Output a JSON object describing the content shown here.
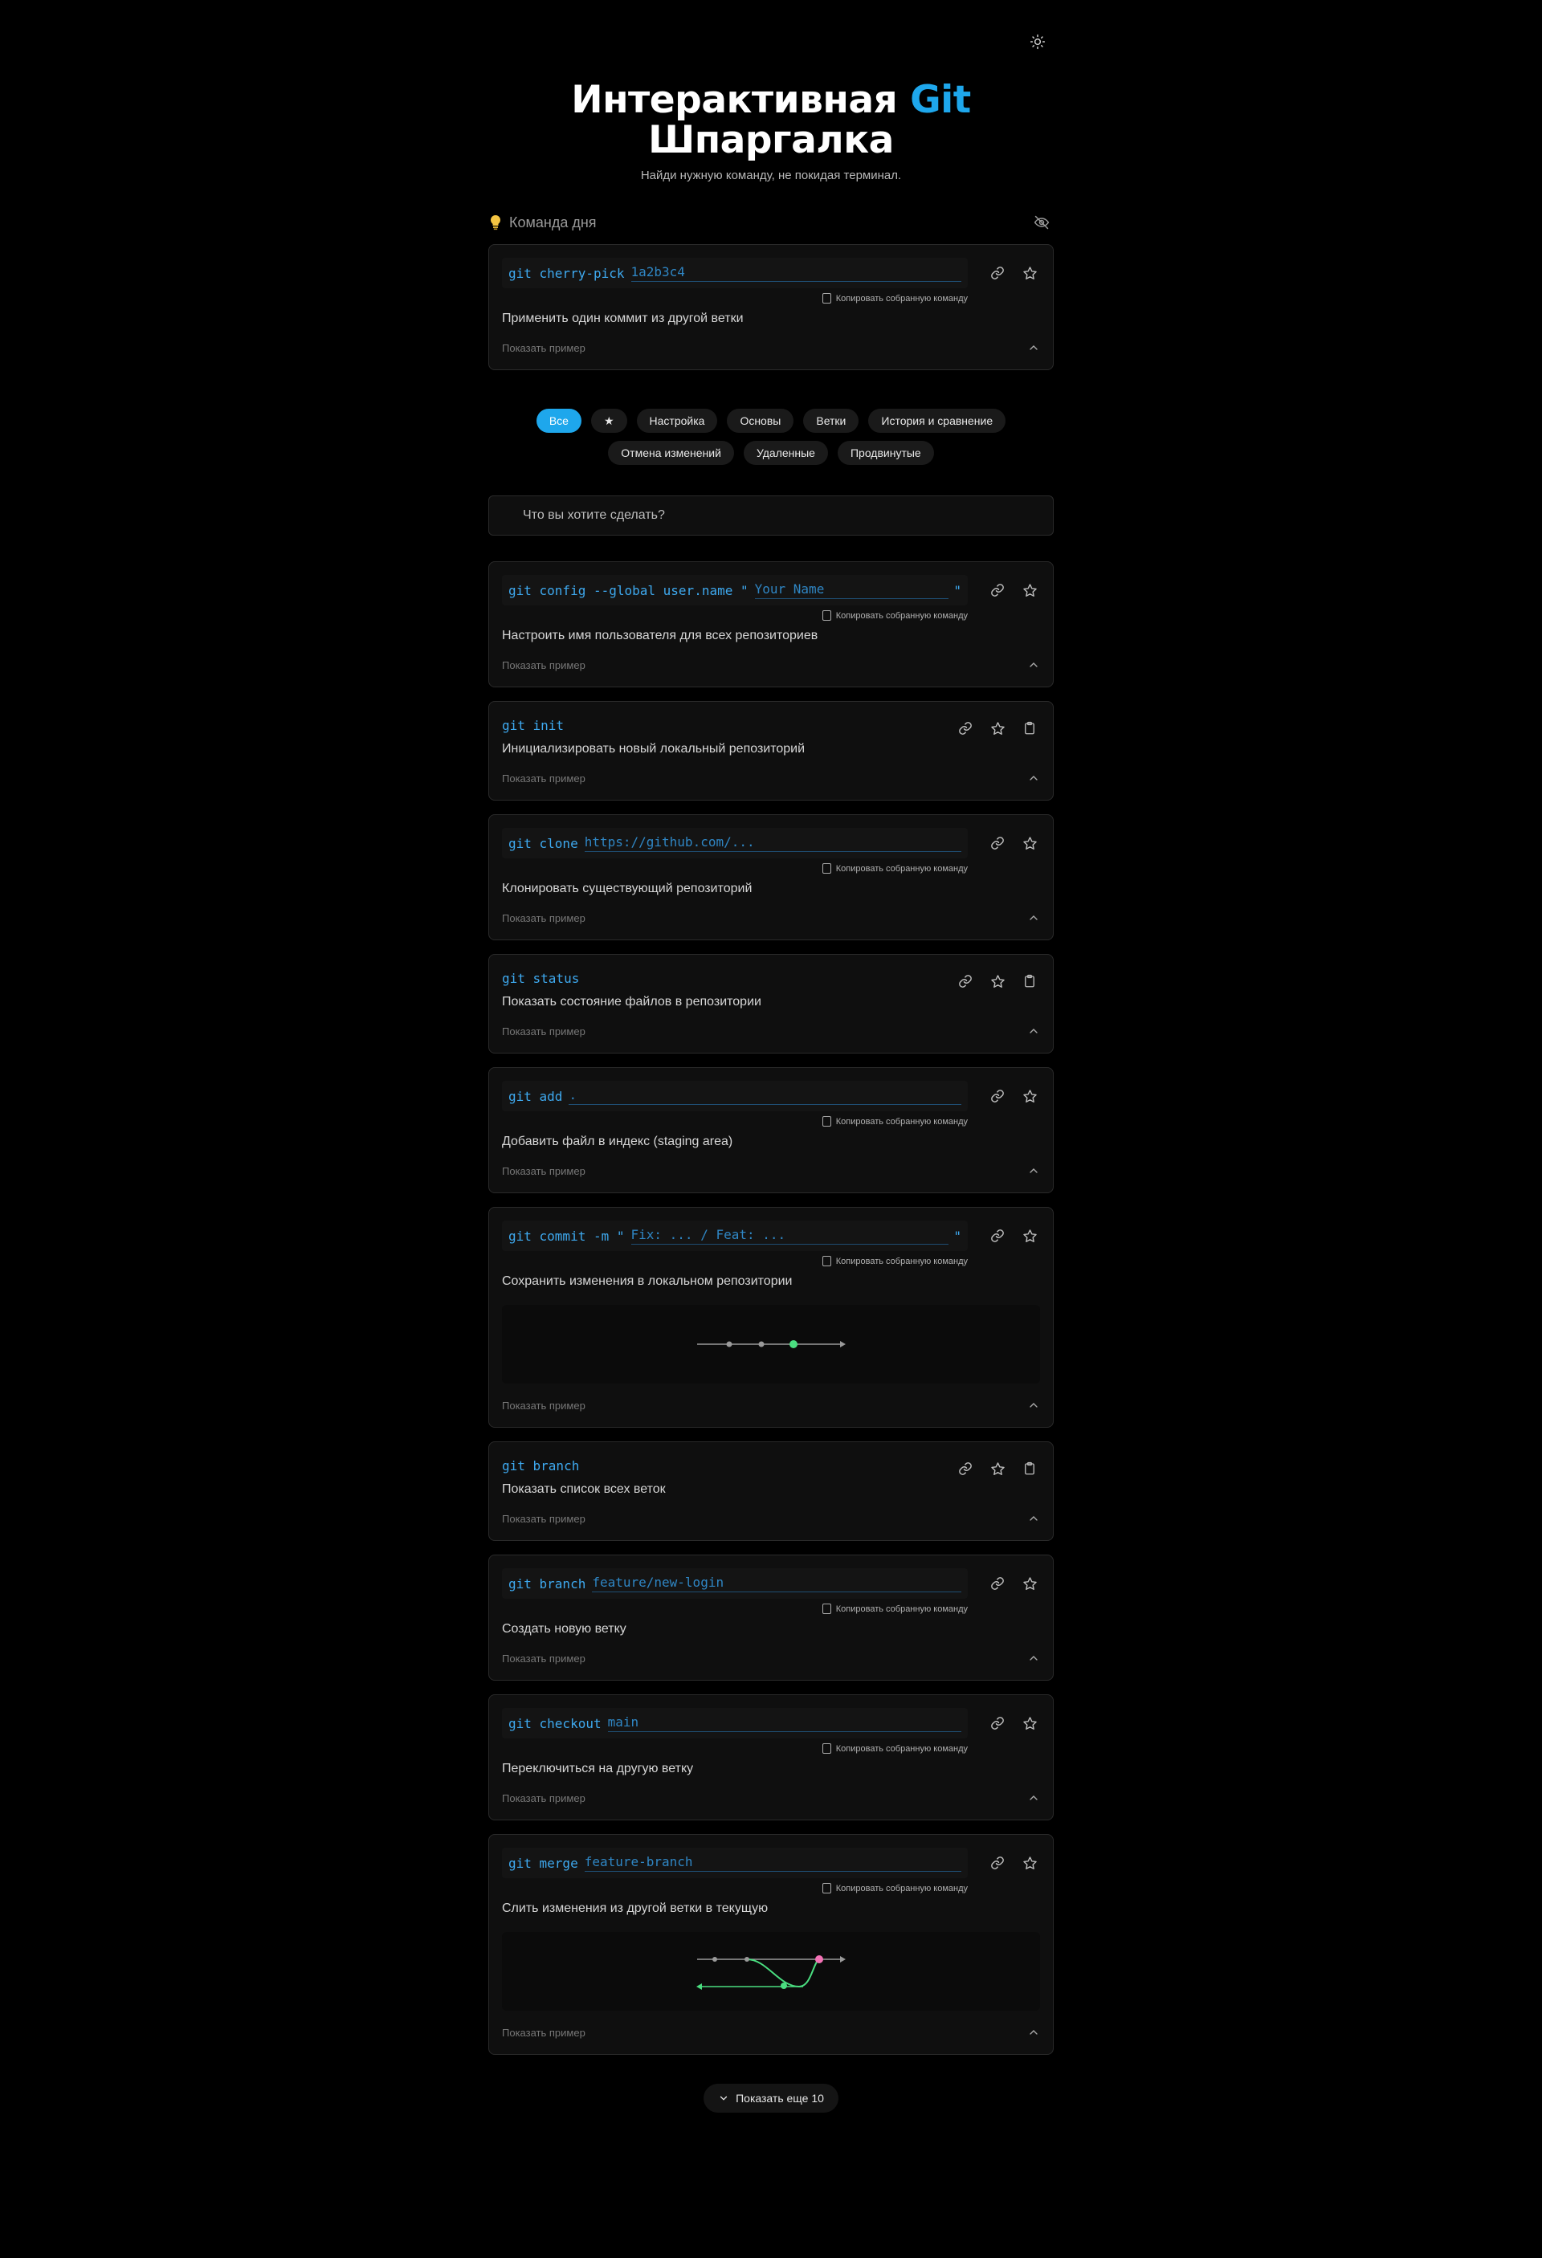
{
  "header": {
    "title_part1": "Интерактивная ",
    "title_accent": "Git",
    "title_part2": "Шпаргалка",
    "subtitle": "Найди нужную команду, не покидая терминал."
  },
  "command_of_day": {
    "label": "Команда дня",
    "command": "git cherry-pick",
    "param": "1a2b3c4",
    "copy_label": "Копировать собранную команду",
    "description": "Применить один коммит из другой ветки",
    "example_label": "Показать пример"
  },
  "filters": [
    "Все",
    "★",
    "Настройка",
    "Основы",
    "Ветки",
    "История и сравнение",
    "Отмена изменений",
    "Удаленные",
    "Продвинутые"
  ],
  "search": {
    "placeholder": "Что вы хотите сделать?"
  },
  "commands": [
    {
      "command": "git config --global user.name \"",
      "param": "Your Name",
      "suffix": "\"",
      "copy_label": "Копировать собранную команду",
      "description": "Настроить имя пользователя для всех репозиториев",
      "example_label": "Показать пример"
    },
    {
      "command": "git init",
      "description": "Инициализировать новый локальный репозиторий",
      "example_label": "Показать пример"
    },
    {
      "command": "git clone",
      "param": "https://github.com/...",
      "copy_label": "Копировать собранную команду",
      "description": "Клонировать существующий репозиторий",
      "example_label": "Показать пример"
    },
    {
      "command": "git status",
      "description": "Показать состояние файлов в репозитории",
      "example_label": "Показать пример"
    },
    {
      "command": "git add",
      "param": ".",
      "copy_label": "Копировать собранную команду",
      "description": "Добавить файл в индекс (staging area)",
      "example_label": "Показать пример"
    },
    {
      "command": "git commit -m \"",
      "param": "Fix: ... / Feat: ...",
      "suffix": "\"",
      "copy_label": "Копировать собранную команду",
      "description": "Сохранить изменения в локальном репозитории",
      "example_label": "Показать пример"
    },
    {
      "command": "git branch",
      "description": "Показать список всех веток",
      "example_label": "Показать пример"
    },
    {
      "command": "git branch",
      "param": "feature/new-login",
      "copy_label": "Копировать собранную команду",
      "description": "Создать новую ветку",
      "example_label": "Показать пример"
    },
    {
      "command": "git checkout",
      "param": "main",
      "copy_label": "Копировать собранную команду",
      "description": "Переключиться на другую ветку",
      "example_label": "Показать пример"
    },
    {
      "command": "git merge",
      "param": "feature-branch",
      "copy_label": "Копировать собранную команду",
      "description": "Слить изменения из другой ветки в текущую",
      "example_label": "Показать пример"
    }
  ],
  "more_button": "Показать еще 10",
  "colors": {
    "accent": "#1ea7ec",
    "commit_dot": "#4ade80",
    "merge_dot": "#f472b6"
  }
}
